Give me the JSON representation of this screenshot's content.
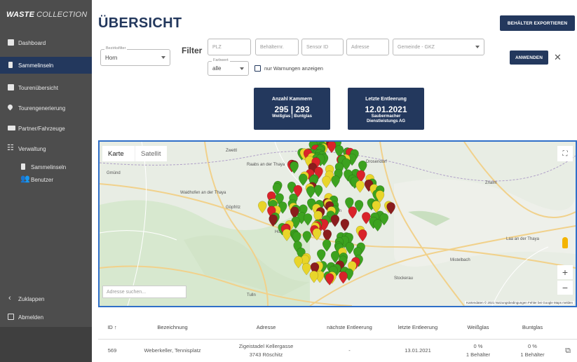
{
  "app": {
    "brand_bold": "WASTE",
    "brand_rest": "COLLECTION"
  },
  "sidebar": {
    "items": [
      {
        "label": "Dashboard",
        "icon": "dashboard-icon"
      },
      {
        "label": "Sammelinseln",
        "icon": "bin-icon",
        "active": true
      },
      {
        "label": "Tourenübersicht",
        "icon": "book-icon"
      },
      {
        "label": "Tourengenerierung",
        "icon": "location-pin-icon"
      },
      {
        "label": "Partner/Fahrzeuge",
        "icon": "truck-icon"
      },
      {
        "label": "Verwaltung",
        "icon": "hierarchy-icon"
      },
      {
        "label": "Sammelinseln",
        "icon": "bin-icon"
      },
      {
        "label": "Benutzer",
        "icon": "users-icon"
      }
    ],
    "collapse_label": "Zuklappen",
    "logout_label": "Abmelden"
  },
  "header": {
    "title": "ÜBERSICHT",
    "export_button": "BEHÄLTER EXPORTIEREN"
  },
  "filter": {
    "label": "Filter",
    "region": {
      "floating": "Bezirksfilter",
      "value": "Horn"
    },
    "inputs": [
      "PLZ",
      "Behälternr.",
      "Sensor ID",
      "Adresse"
    ],
    "municipality": "Gemeinde - GKZ",
    "warning_select": {
      "floating": "Farbwert",
      "value": "alle"
    },
    "show_warnings": "nur Warnungen anzeigen",
    "apply_button": "ANWENDEN",
    "close_symbol": "✕"
  },
  "stats": [
    {
      "title": "Anzahl Kammern",
      "value": "295 | 293",
      "sub": "Weißglas | Buntglas"
    },
    {
      "title": "Letzte Entleerung",
      "value": "12.01.2021",
      "sub": "Saubermacher Dienstleistungs AG"
    }
  ],
  "map": {
    "tabs": [
      "Karte",
      "Satellit"
    ],
    "search_placeholder": "Adresse suchen...",
    "credit": "Kartendaten © 2021   Nutzungsbedingungen   Fehler bei Google Maps melden",
    "place_labels": [
      "Zwettl",
      "Gmünd",
      "Horn",
      "Krems",
      "Znaim",
      "Laa an der Thaya",
      "Mistelbach",
      "Tulln",
      "Stockerau",
      "Hollabrunn",
      "Waidhofen an der Thaya",
      "Göpfritz",
      "Raabs an der Thaya",
      "Drosendorf"
    ],
    "marker_colors": {
      "green": "#3ca21f",
      "yellow": "#e8d52a",
      "red": "#d9232a",
      "darkred": "#8b1d1d"
    }
  },
  "table": {
    "columns": [
      "ID ↑",
      "Bezeichnung",
      "Adresse",
      "nächste Entleerung",
      "letzte Entleerung",
      "Weißglas",
      "Buntglas"
    ],
    "rows": [
      {
        "id": "569",
        "name": "Weberkeller, Tennisplatz",
        "address_line1": "Zigeistadel Kellergasse",
        "address_line2": "3743 Röschitz",
        "next": "-",
        "last": "13.01.2021",
        "white_pct": "0 %",
        "white_count": "1 Behälter",
        "colored_pct": "0 %",
        "colored_count": "1 Behälter"
      }
    ]
  },
  "colors": {
    "primary": "#23385d",
    "sidebar": "#4d4d4d",
    "map_border": "#2f6fc8"
  }
}
